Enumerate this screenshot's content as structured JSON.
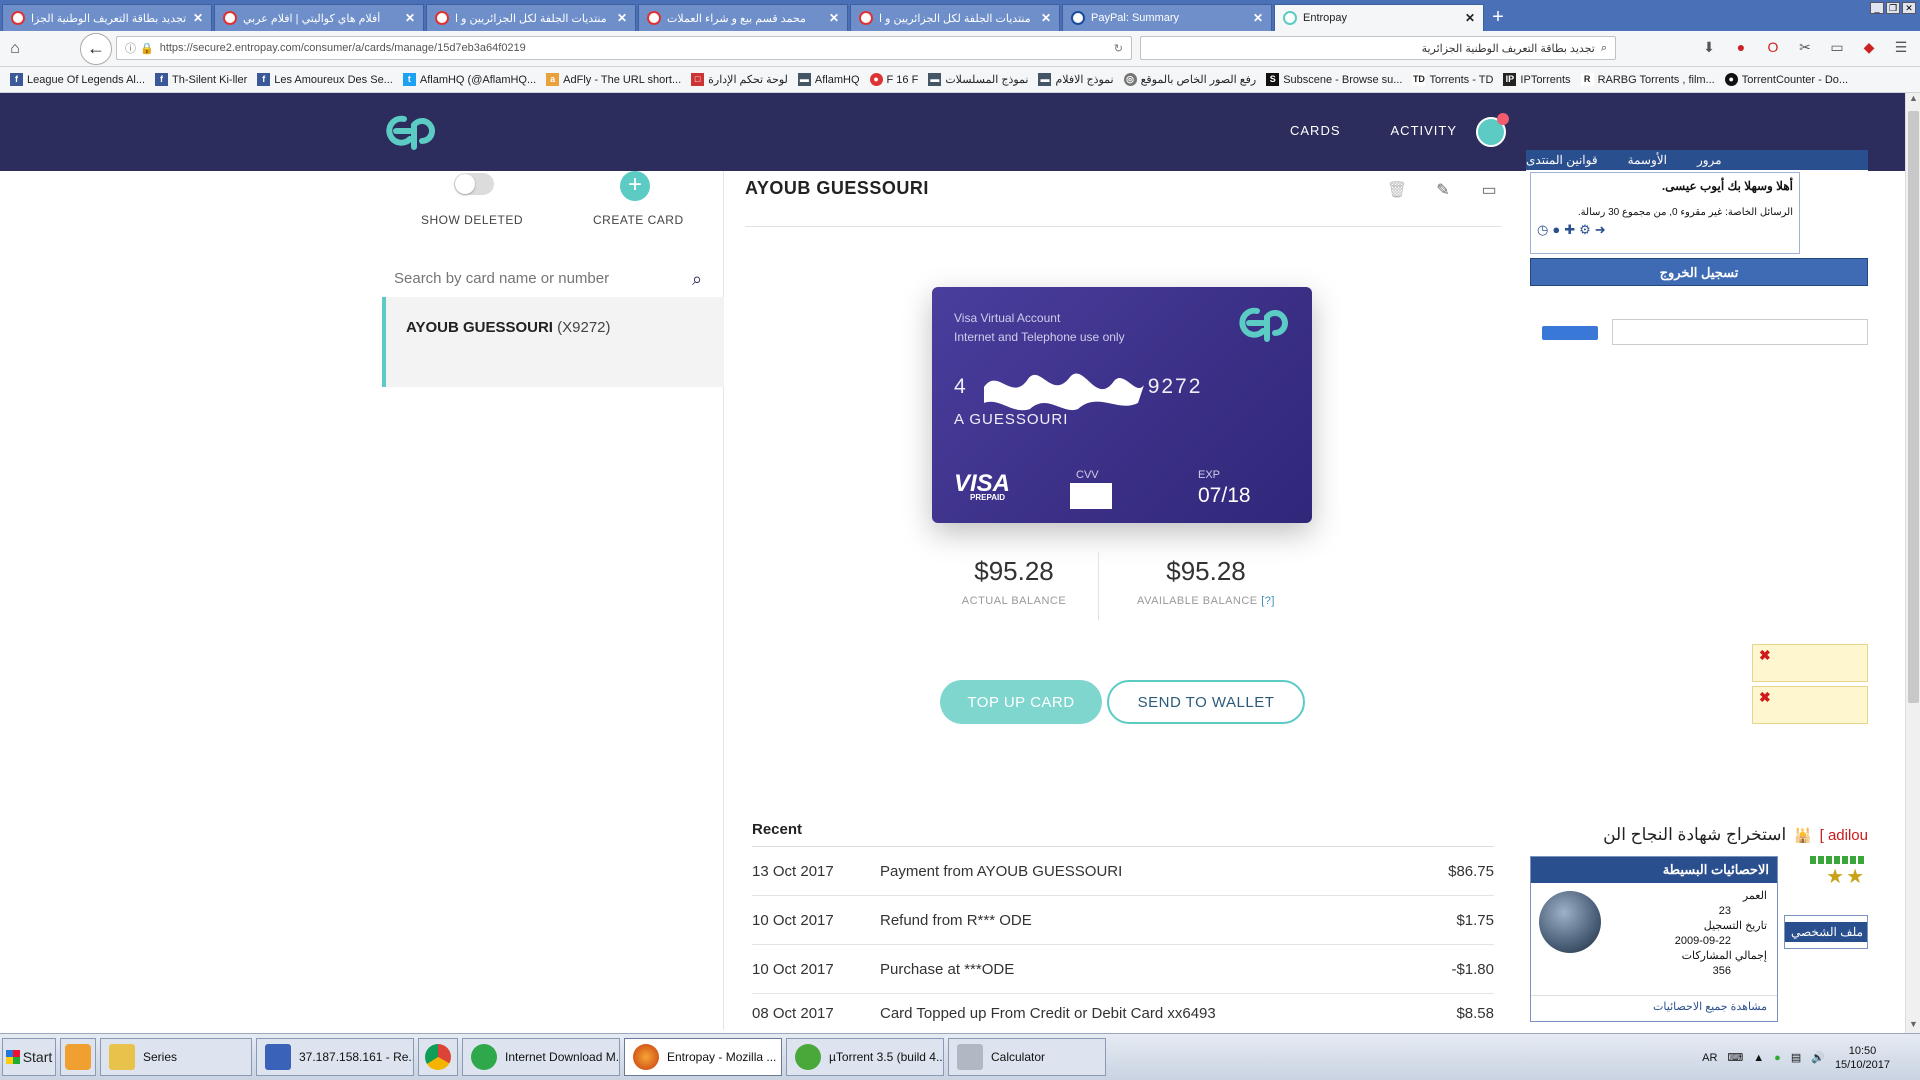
{
  "browser": {
    "tabs": [
      {
        "title": "تجديد بطاقة التعريف الوطنية الجزا",
        "active": false
      },
      {
        "title": "أفلام هاي كواليتي | افلام عربي",
        "active": false
      },
      {
        "title": "منتديات الجلفة لكل الجزائريين و ا",
        "active": false
      },
      {
        "title": "محمد قسم بيع و شراء العملات",
        "active": false
      },
      {
        "title": "منتديات الجلفة لكل الجزائريين و ا",
        "active": false
      },
      {
        "title": "PayPal: Summary",
        "active": false
      },
      {
        "title": "Entropay",
        "active": true
      }
    ],
    "url": "https://secure2.entropay.com/consumer/a/cards/manage/15d7eb3a64f0219",
    "search_value": "تجديد بطاقة التعريف الوطنية الجزائرية",
    "bookmarks": [
      "League Of Legends Al...",
      "Th-Silent Ki-ller",
      "Les Amoureux Des Se...",
      "AflamHQ (@AflamHQ...",
      "AdFly - The URL short...",
      "لوحة تحكم الإدارة",
      "AflamHQ",
      "F 16 F",
      "نموذج المسلسلات",
      "نموذج الافلام",
      "رفع الصور الخاص بالموقع",
      "Subscene - Browse su...",
      "Torrents - TD",
      "IPTorrents",
      "RARBG Torrents , film...",
      "TorrentCounter - Do..."
    ]
  },
  "header": {
    "nav": [
      "CARDS",
      "ACTIVITY"
    ],
    "brand_color": "#2c2d5c",
    "accent_color": "#5bcbc4"
  },
  "left_panel": {
    "show_deleted_label": "SHOW DELETED",
    "create_card_label": "CREATE CARD",
    "search_placeholder": "Search by card name or number",
    "card_item": {
      "name": "AYOUB GUESSOURI",
      "number": "(X9272)"
    }
  },
  "main": {
    "title": "AYOUB GUESSOURI",
    "card": {
      "type_line1": "Visa Virtual Account",
      "type_line2": "Internet and Telephone use only",
      "number_prefix": "4",
      "number_suffix": "9272",
      "holder": "A GUESSOURI",
      "brand": "VISA",
      "brand_sub": "PREPAID",
      "cvv_label": "CVV",
      "exp_label": "EXP",
      "exp": "07/18"
    },
    "actual_balance": "$95.28",
    "actual_balance_label": "ACTUAL BALANCE",
    "available_balance": "$95.28",
    "available_balance_label": "AVAILABLE BALANCE",
    "available_balance_help": "[?]",
    "topup_label": "TOP UP CARD",
    "wallet_label": "SEND TO WALLET",
    "recent_title": "Recent",
    "transactions": [
      {
        "date": "13 Oct 2017",
        "desc": "Payment from AYOUB GUESSOURI",
        "amount": "$86.75"
      },
      {
        "date": "10 Oct 2017",
        "desc": "Refund from R*** ODE",
        "amount": "$1.75"
      },
      {
        "date": "10 Oct 2017",
        "desc": "Purchase at ***ODE",
        "amount": "-$1.80"
      },
      {
        "date": "08 Oct 2017",
        "desc": "Card Topped up From Credit or Debit Card xx6493",
        "amount": "$8.58"
      }
    ]
  },
  "forum": {
    "tabs": [
      "مرور",
      "الأوسمة",
      "قوانين المنتدى"
    ],
    "welcome": "أهلا وسهلا بك أيوب عيسى.",
    "messages": "الرسائل الخاصة: غير مقروء 0, من مجموع 30 رسالة.",
    "logout": "تسجيل الخروج",
    "banner_user": "adilou ]",
    "banner_text": "استخراج شهادة النجاح الن",
    "stats_title": "الاحصائيات البسيطة",
    "stats": [
      {
        "label": "العمر",
        "value": "23"
      },
      {
        "label": "تاريخ التسجيل",
        "value": "2009-09-22"
      },
      {
        "label": "إجمالي المشاركات",
        "value": "356"
      }
    ],
    "stats_footer": "مشاهدة جميع الاحصائيات",
    "profile_tab": "ملف الشخصي"
  },
  "taskbar": {
    "start": "Start",
    "items": [
      {
        "label": "Series",
        "active": false
      },
      {
        "label": "37.187.158.161 - Re...",
        "active": false
      },
      {
        "label": "Internet Download M...",
        "active": false
      },
      {
        "label": "Entropay - Mozilla ...",
        "active": true
      },
      {
        "label": "µTorrent 3.5 (build 4...",
        "active": false
      },
      {
        "label": "Calculator",
        "active": false
      }
    ],
    "lang": "AR",
    "time": "10:50",
    "date": "15/10/2017"
  }
}
